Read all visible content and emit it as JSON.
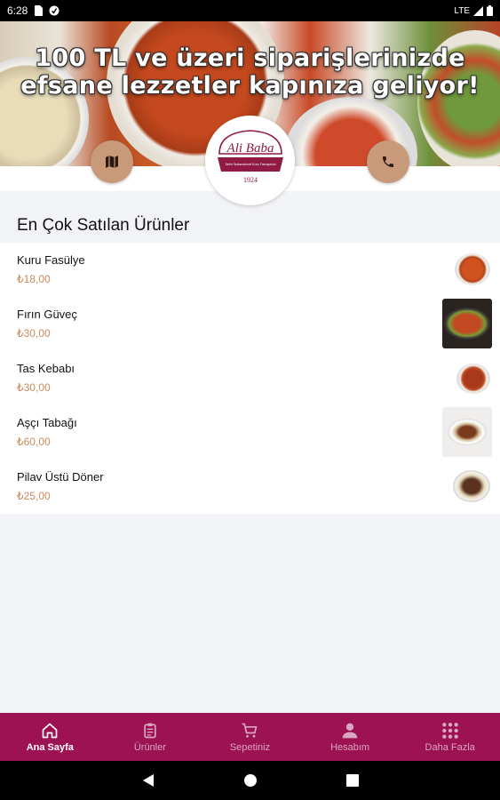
{
  "status_bar": {
    "time": "6:28",
    "network": "LTE"
  },
  "hero": {
    "line1": "100 TL ve üzeri siparişlerinizde",
    "line2": "efsane lezzetler kapınıza geliyor!"
  },
  "logo": {
    "brand": "Ali Baba",
    "tagline": "Tarihi Sultanahmet Kuru Fasulyecisi",
    "year": "1924"
  },
  "section_title": "En Çok Satılan Ürünler",
  "products": [
    {
      "name": "Kuru Fasülye",
      "price": "₺18,00"
    },
    {
      "name": "Fırın Güveç",
      "price": "₺30,00"
    },
    {
      "name": "Tas Kebabı",
      "price": "₺30,00"
    },
    {
      "name": "Aşçı Tabağı",
      "price": "₺60,00"
    },
    {
      "name": "Pilav Üstü Döner",
      "price": "₺25,00"
    }
  ],
  "nav": [
    {
      "label": "Ana Sayfa",
      "icon": "home-icon"
    },
    {
      "label": "Ürünler",
      "icon": "clipboard-icon"
    },
    {
      "label": "Sepetiniz",
      "icon": "cart-icon"
    },
    {
      "label": "Hesabım",
      "icon": "user-icon"
    },
    {
      "label": "Daha Fazla",
      "icon": "grid-icon"
    }
  ],
  "colors": {
    "nav_bg": "#9c1253",
    "price": "#c98a5c",
    "round_button": "#c89a7a",
    "brand": "#8f1a44"
  }
}
